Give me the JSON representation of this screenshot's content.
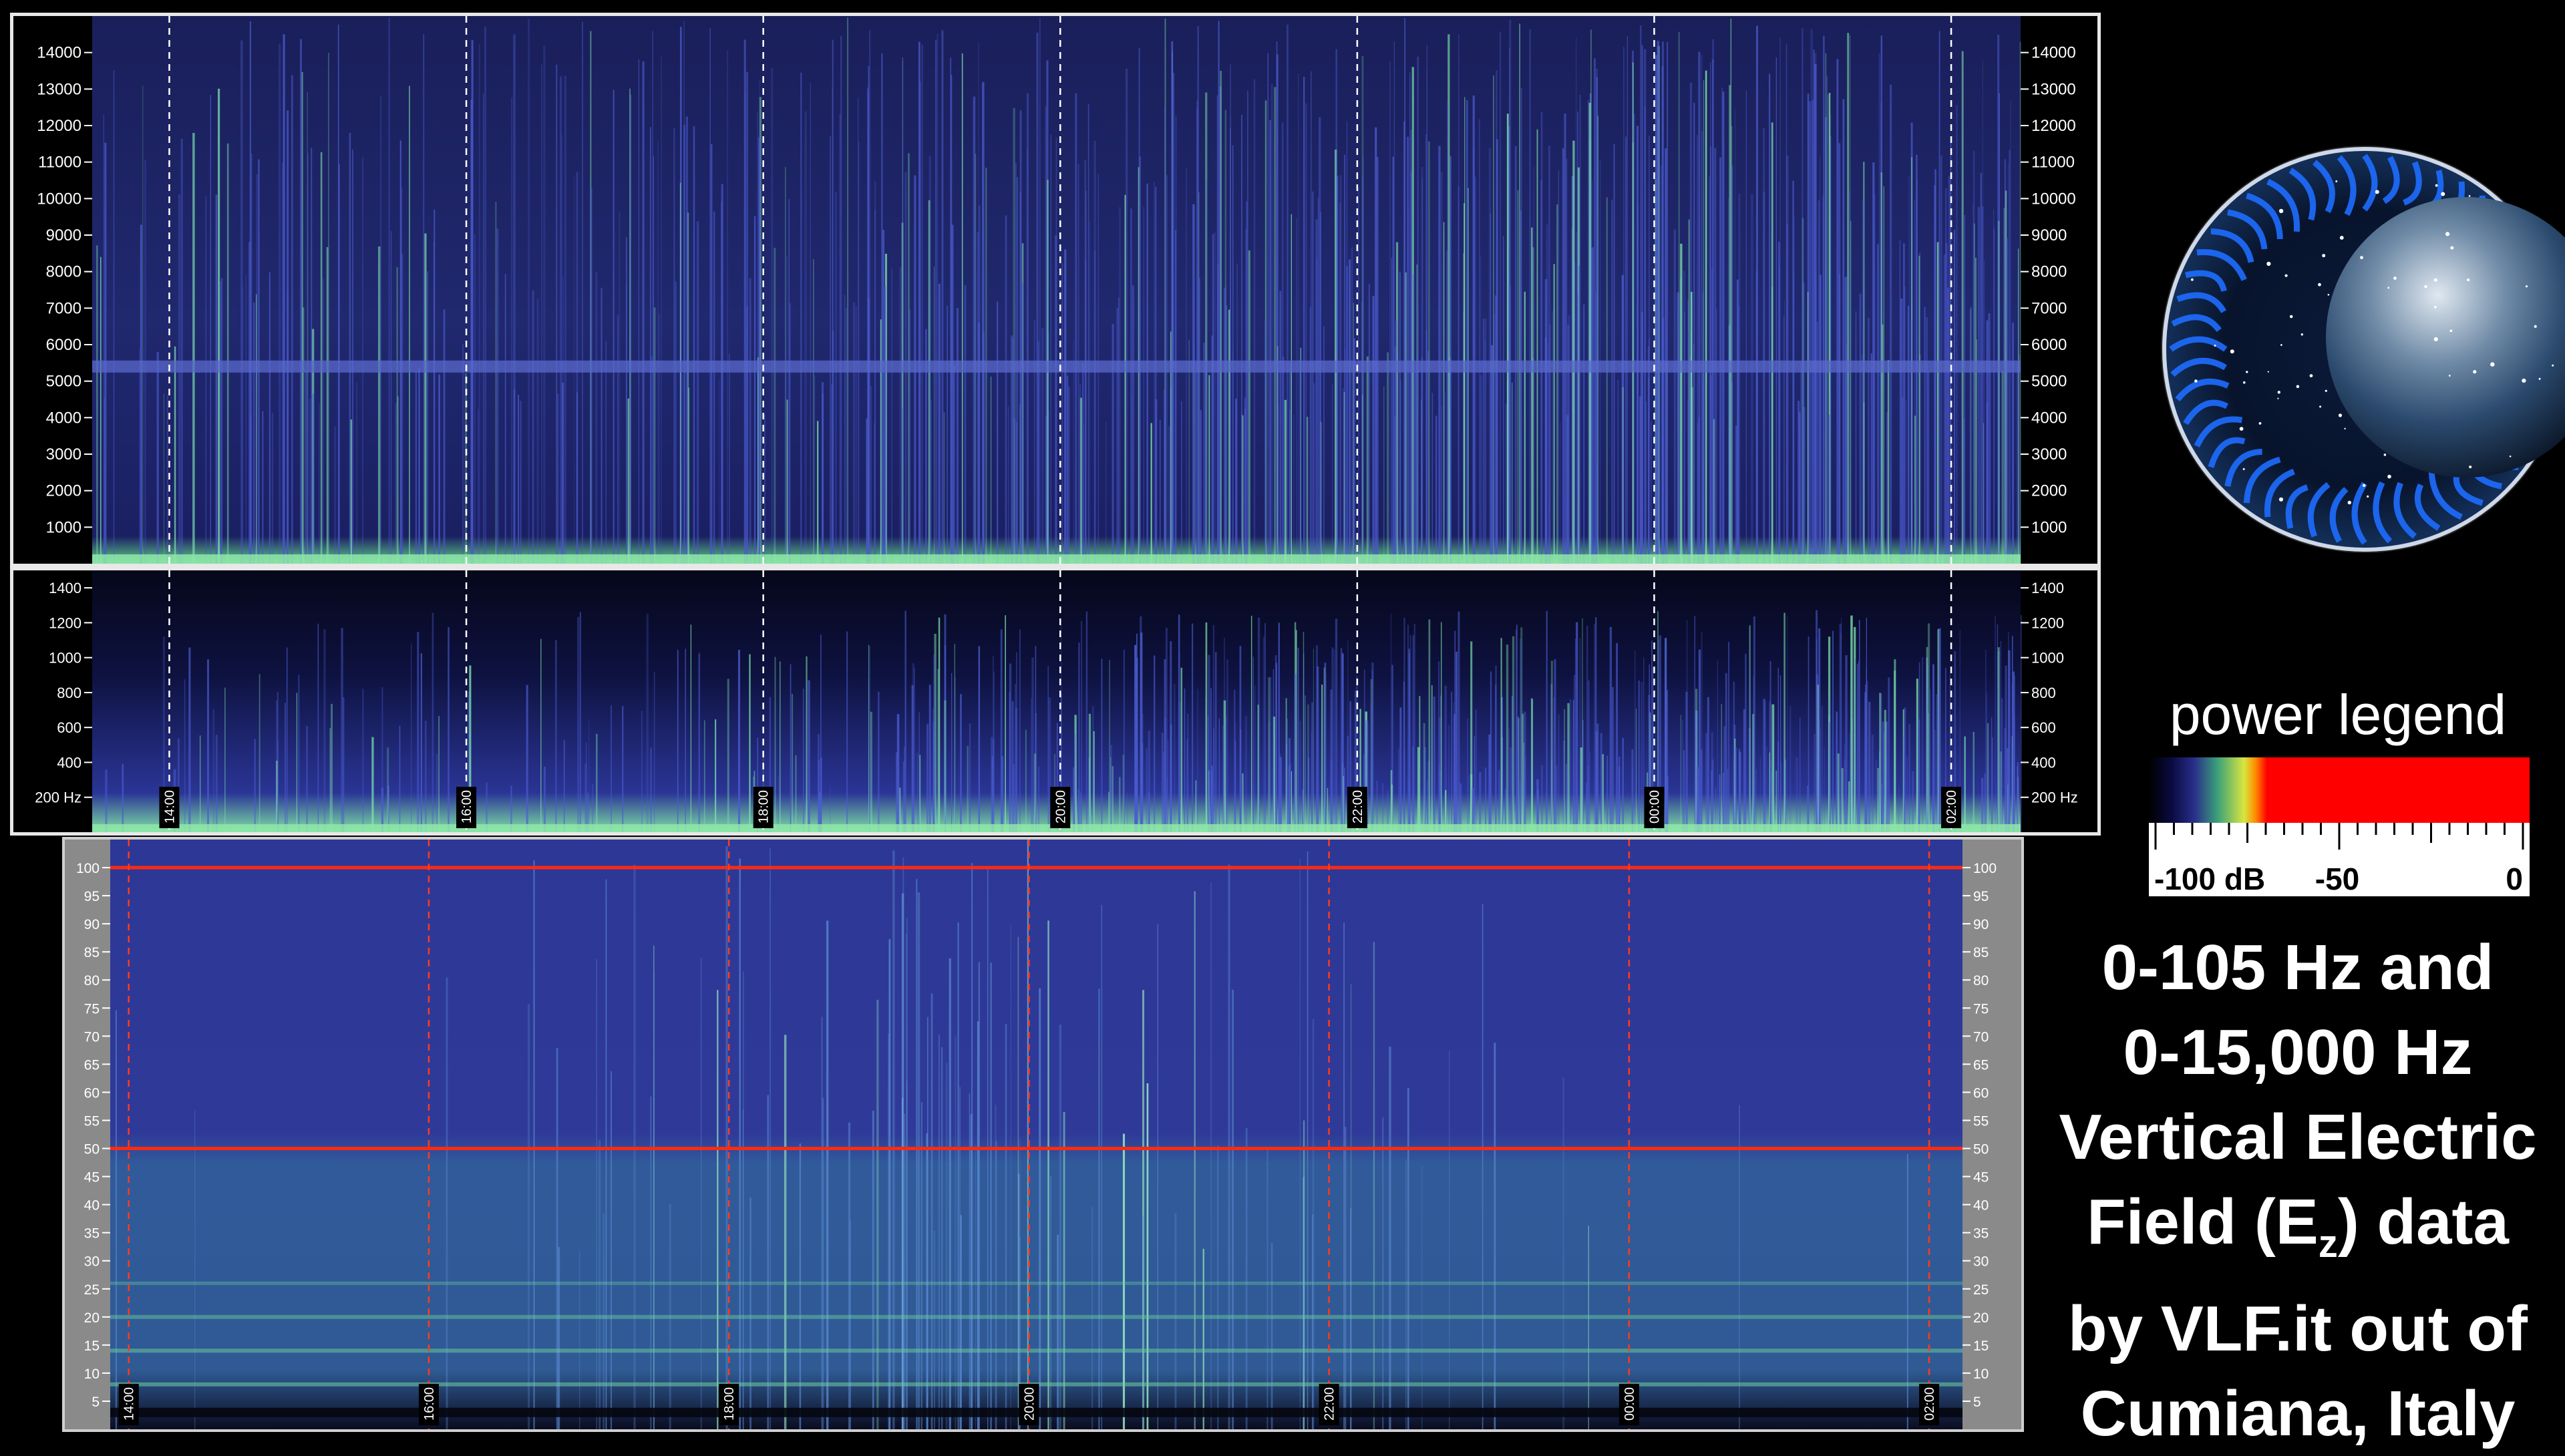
{
  "chart_data": [
    {
      "type": "heatmap",
      "title": "",
      "time_ticks": [
        "14:00",
        "16:00",
        "18:00",
        "20:00",
        "22:00",
        "00:00",
        "02:00"
      ],
      "y_ticks": [
        "1000",
        "2000",
        "3000",
        "4000",
        "5000",
        "6000",
        "7000",
        "8000",
        "9000",
        "10000",
        "11000",
        "12000",
        "13000",
        "14000"
      ],
      "ylim": [
        0,
        15000
      ],
      "unit": "Hz",
      "features": [
        {
          "y": 5400,
          "label": "horizontal band"
        }
      ],
      "grid": true
    },
    {
      "type": "heatmap",
      "title": "",
      "time_ticks": [
        "14:00",
        "16:00",
        "18:00",
        "20:00",
        "22:00",
        "00:00",
        "02:00"
      ],
      "y_ticks": [
        "200 Hz",
        "400",
        "600",
        "800",
        "1000",
        "1200",
        "1400"
      ],
      "ylim": [
        0,
        1500
      ],
      "unit": "Hz",
      "grid": true
    },
    {
      "type": "heatmap",
      "title": "",
      "time_ticks": [
        "14:00",
        "16:00",
        "18:00",
        "20:00",
        "22:00",
        "00:00",
        "02:00"
      ],
      "y_ticks": [
        "5",
        "10",
        "15",
        "20",
        "25",
        "30",
        "35",
        "40",
        "45",
        "50",
        "55",
        "60",
        "65",
        "70",
        "75",
        "80",
        "85",
        "90",
        "95",
        "100"
      ],
      "ylim": [
        0,
        105
      ],
      "unit": "Hz",
      "reference_lines": [
        50,
        100
      ],
      "grid": true
    }
  ],
  "legend": {
    "title": "power legend",
    "labels": [
      "-100 dB",
      "-50",
      "0"
    ],
    "colors": [
      "#000000",
      "#2a2f8a",
      "#3aa07a",
      "#d7e640",
      "#ff0000"
    ]
  },
  "caption": {
    "line1": "0-105 Hz and",
    "line2": "0-15,000 Hz",
    "line3": "Vertical Electric",
    "line4_pre": "Field (E",
    "line4_sub": "z",
    "line4_post": ") data",
    "line5": "by VLF.it out of",
    "line6": "Cumiana, Italy"
  },
  "colors": {
    "background": "#000000",
    "spectrogram_base": "#2a3185",
    "signal_green": "#7fe6b0",
    "reference_line": "#ff2a10"
  }
}
